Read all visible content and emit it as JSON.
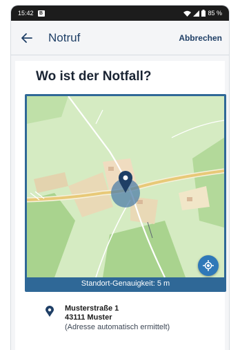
{
  "status_bar": {
    "time": "15:42",
    "notification_icon": "B",
    "battery": "85 %"
  },
  "app_bar": {
    "title": "Notruf",
    "cancel_label": "Abbrechen",
    "back_icon": "arrow-left-icon"
  },
  "main": {
    "question": "Wo ist der Notfall?",
    "map": {
      "accuracy_text": "Standort-Genauigkeit: 5 m",
      "locate_icon": "my-location-icon",
      "marker_icon": "map-pin-icon"
    },
    "address": {
      "street": "Musterstraße 1",
      "city": "43111 Muster",
      "note": "(Adresse automatisch ermittelt)"
    }
  },
  "colors": {
    "brand_blue": "#2f6897",
    "title_blue": "#1f3f66",
    "map_green": "#cfe8b8",
    "field_tan": "#e9d9b6"
  }
}
